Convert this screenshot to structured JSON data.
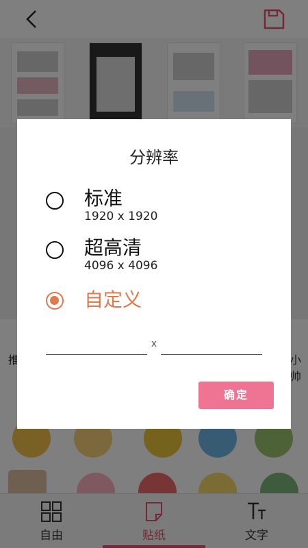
{
  "app": {
    "accent_color": "#e2536e",
    "orange_accent": "#e07a4c"
  },
  "topbar": {
    "back_icon": "chevron-left-icon",
    "save_icon": "save-icon"
  },
  "background": {
    "left_text": "推",
    "right_text": "小帅"
  },
  "bottom_nav": {
    "items": [
      {
        "label": "自由",
        "icon": "grid-icon"
      },
      {
        "label": "贴纸",
        "icon": "sticker-icon",
        "active": true
      },
      {
        "label": "文字",
        "icon": "text-size-icon"
      }
    ]
  },
  "dialog": {
    "title": "分辨率",
    "options": [
      {
        "label": "标准",
        "sub": "1920 x 1920",
        "checked": false
      },
      {
        "label": "超高清",
        "sub": "4096 x 4096",
        "checked": false
      },
      {
        "label": "自定义",
        "sub": "",
        "checked": true
      }
    ],
    "custom": {
      "width_value": "",
      "height_value": "",
      "separator": "x"
    },
    "confirm_label": "确定"
  }
}
